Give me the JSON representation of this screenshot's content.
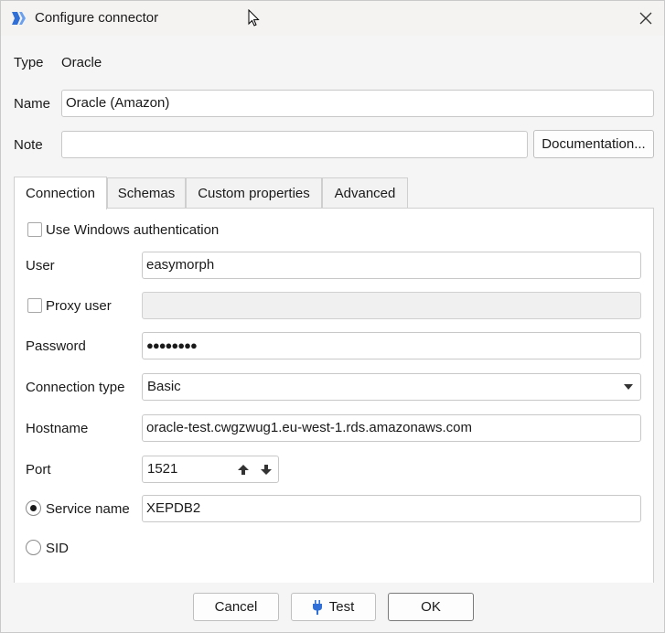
{
  "window": {
    "title": "Configure connector"
  },
  "type_row": {
    "label": "Type",
    "value": "Oracle"
  },
  "name_row": {
    "label": "Name",
    "value": "Oracle (Amazon)"
  },
  "note_row": {
    "label": "Note",
    "value": "",
    "doc_button": "Documentation..."
  },
  "tabs": [
    {
      "label": "Connection",
      "active": true
    },
    {
      "label": "Schemas"
    },
    {
      "label": "Custom properties"
    },
    {
      "label": "Advanced"
    }
  ],
  "connection": {
    "windows_auth": {
      "label": "Use Windows authentication",
      "checked": false
    },
    "user": {
      "label": "User",
      "value": "easymorph"
    },
    "proxy_user": {
      "label": "Proxy user",
      "checked": false,
      "value": ""
    },
    "password": {
      "label": "Password",
      "value": "●●●●●●●●"
    },
    "connection_type": {
      "label": "Connection type",
      "value": "Basic"
    },
    "hostname": {
      "label": "Hostname",
      "value": "oracle-test.cwgzwug1.eu-west-1.rds.amazonaws.com"
    },
    "port": {
      "label": "Port",
      "value": "1521"
    },
    "service_name": {
      "label": "Service name",
      "value": "XEPDB2",
      "selected": true
    },
    "sid": {
      "label": "SID",
      "selected": false
    }
  },
  "footer": {
    "cancel": "Cancel",
    "test": "Test",
    "ok": "OK"
  },
  "colors": {
    "accent": "#2f6fd6",
    "border": "#c8c8c8"
  }
}
